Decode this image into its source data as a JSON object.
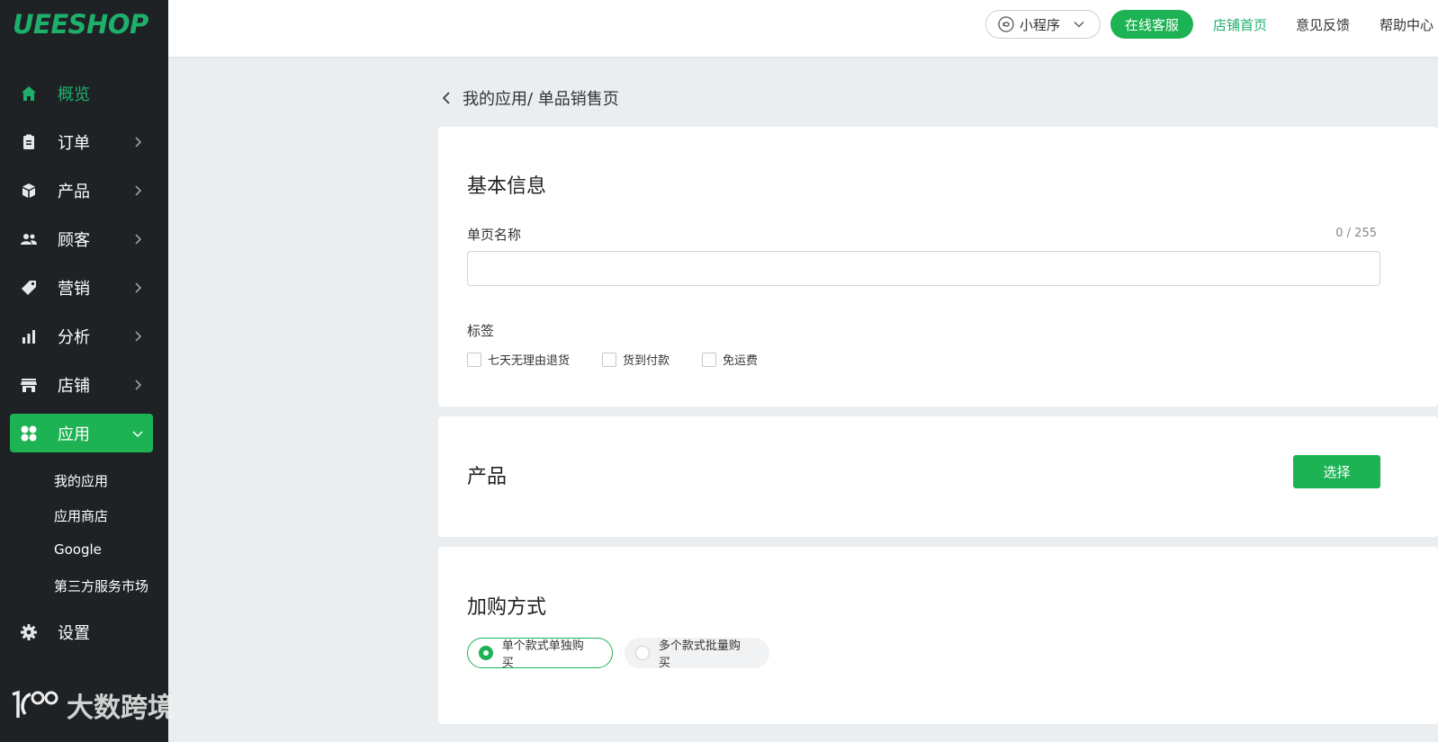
{
  "brand": {
    "logo": "UEESHOP"
  },
  "sidebar": {
    "items": [
      {
        "label": "概览",
        "icon": "home-icon"
      },
      {
        "label": "订单",
        "icon": "clipboard-icon"
      },
      {
        "label": "产品",
        "icon": "box-icon"
      },
      {
        "label": "顾客",
        "icon": "users-icon"
      },
      {
        "label": "营销",
        "icon": "tag-icon"
      },
      {
        "label": "分析",
        "icon": "bar-chart-icon"
      },
      {
        "label": "店铺",
        "icon": "store-icon"
      },
      {
        "label": "应用",
        "icon": "apps-icon"
      }
    ],
    "sub_items": [
      "我的应用",
      "应用商店",
      "Google",
      "第三方服务市场"
    ],
    "settings": {
      "label": "设置",
      "icon": "gear-icon"
    }
  },
  "topbar": {
    "mini_program": "小程序",
    "online_service": "在线客服",
    "store_home": "店铺首页",
    "feedback": "意见反馈",
    "help": "帮助中心"
  },
  "breadcrumb": {
    "text": "我的应用/ 单品销售页"
  },
  "basic_info": {
    "title": "基本信息",
    "name_label": "单页名称",
    "name_counter": "0 / 255",
    "name_value": "",
    "tags_label": "标签",
    "tags": [
      "七天无理由退货",
      "货到付款",
      "免运费"
    ]
  },
  "product": {
    "title": "产品",
    "select_label": "选择"
  },
  "purchase_mode": {
    "title": "加购方式",
    "options": [
      "单个款式单独购买",
      "多个款式批量购买"
    ],
    "selected": "单个款式单独购买"
  },
  "watermark": {
    "text": "大数跨境"
  },
  "colors": {
    "accent": "#1db354",
    "sidebar_bg": "#1f2225",
    "page_bg": "#eaeef1"
  }
}
